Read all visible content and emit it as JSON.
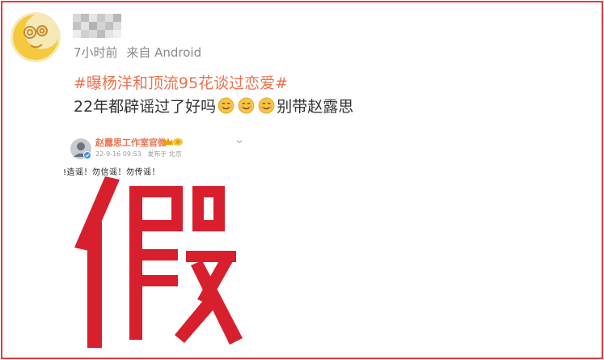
{
  "post": {
    "time": "7小时前",
    "source": "来自 Android",
    "hashtag": "#曝杨洋和顶流95花谈过恋爱#",
    "text_before": "22年都辟谣过了好吗",
    "text_after": "别带赵露思",
    "emoticon": "smiling-face-icon"
  },
  "embed": {
    "account_name": "赵露思工作室官微",
    "badge": "crown-badge-icon",
    "date": "22-9-16 09:53",
    "location": "发布于 北京",
    "statement": "!造谣！勿信谣！勿传谣！",
    "big_character": "假"
  },
  "colors": {
    "frame_border": "#e8383d",
    "hashtag": "#eb7350",
    "big_character": "#d71f2e"
  }
}
